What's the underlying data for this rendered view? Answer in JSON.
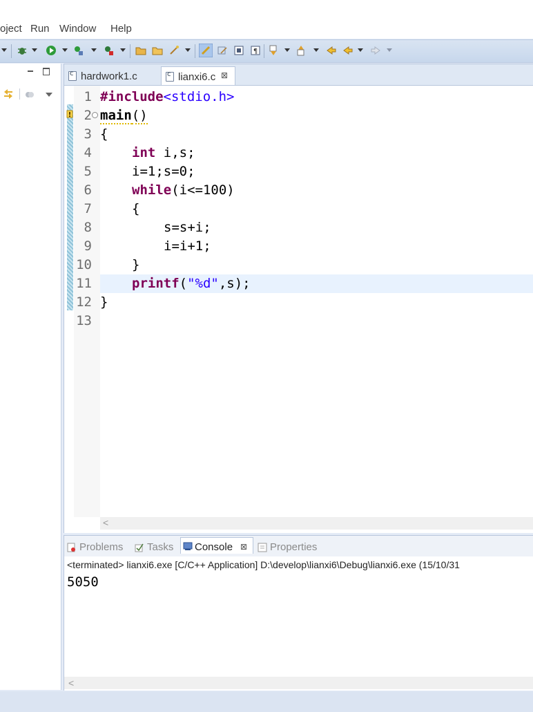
{
  "menu": [
    "oject",
    "Run",
    "Window",
    "Help"
  ],
  "editor": {
    "tabs": [
      {
        "label": "hardwork1.c",
        "active": false
      },
      {
        "label": "lianxi6.c",
        "active": true,
        "close": "⊠"
      }
    ],
    "line_numbers": [
      "1",
      "2",
      "3",
      "4",
      "5",
      "6",
      "7",
      "8",
      "9",
      "10",
      "11",
      "12",
      "13"
    ],
    "current_line": 11,
    "code": {
      "l1_kw": "#include",
      "l1_str": "<stdio.h>",
      "l2_fn": "main",
      "l2_rest": "()",
      "l3": "{",
      "l4_kw": "int",
      "l4_rest": " i,s;",
      "l5": "i=1;s=0;",
      "l6_kw": "while",
      "l6_rest": "(i<=100)",
      "l7": "{",
      "l8": "s=s+i;",
      "l9": "i=i+1;",
      "l10": "}",
      "l11_kw": "printf",
      "l11_open": "(",
      "l11_str": "\"%d\"",
      "l11_rest": ",s);",
      "l12": "}",
      "l13": ""
    }
  },
  "views": {
    "tabs": [
      {
        "label": "Problems",
        "icon": "problems-icon"
      },
      {
        "label": "Tasks",
        "icon": "tasks-icon"
      },
      {
        "label": "Console",
        "icon": "console-icon",
        "close": "⊠"
      },
      {
        "label": "Properties",
        "icon": "properties-icon"
      }
    ]
  },
  "console": {
    "status": "<terminated> lianxi6.exe [C/C++ Application] D:\\develop\\lianxi6\\Debug\\lianxi6.exe (15/10/31",
    "output": "5050"
  },
  "scroll_arrow": "<",
  "colors": {
    "keyword": "#7f0055",
    "string": "#2a00ff",
    "current_line": "#e8f2fe",
    "toolbar": "#c7d7ec"
  }
}
